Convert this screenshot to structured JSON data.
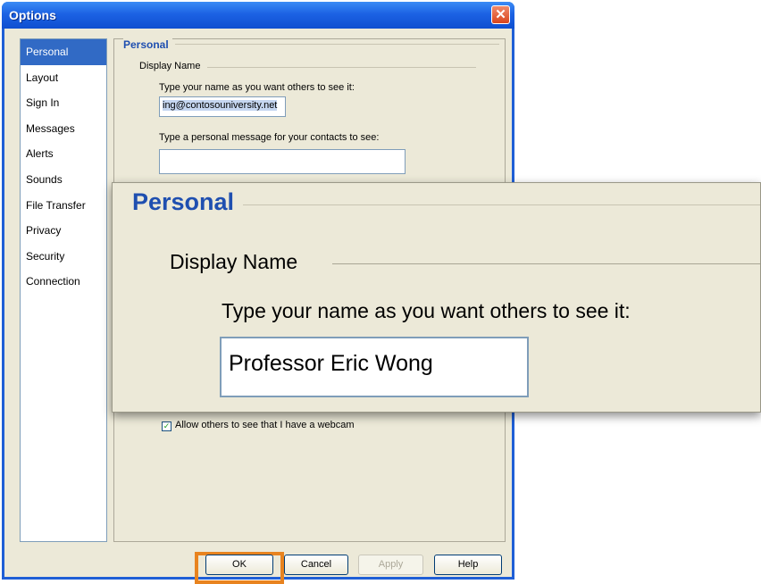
{
  "window": {
    "title": "Options",
    "close_glyph": "✕"
  },
  "nav": {
    "items": [
      {
        "label": "Personal",
        "selected": true
      },
      {
        "label": "Layout"
      },
      {
        "label": "Sign In"
      },
      {
        "label": "Messages"
      },
      {
        "label": "Alerts"
      },
      {
        "label": "Sounds"
      },
      {
        "label": "File Transfer"
      },
      {
        "label": "Privacy"
      },
      {
        "label": "Security"
      },
      {
        "label": "Connection"
      }
    ]
  },
  "personal": {
    "section_title": "Personal",
    "group_title": "Display Name",
    "name_prompt": "Type your name as you want others to see it:",
    "name_value": "ing@contosouniversity.net",
    "message_prompt": "Type a personal message for your contacts to see:",
    "message_value": "",
    "webcam_checkbox": {
      "label": "Allow others to see that I have a webcam",
      "checked": true,
      "glyph": "✓"
    }
  },
  "zoom": {
    "section_title": "Personal",
    "group_title": "Display Name",
    "name_prompt": "Type your name as you want others to see it:",
    "name_value": "Professor Eric Wong"
  },
  "buttons": {
    "ok": "OK",
    "cancel": "Cancel",
    "apply": "Apply",
    "help": "Help"
  },
  "colors": {
    "title_bar": "#1c62e4",
    "selection": "#316ac5",
    "focus_highlight": "#e8831f",
    "header_text": "#1f4fb0"
  }
}
